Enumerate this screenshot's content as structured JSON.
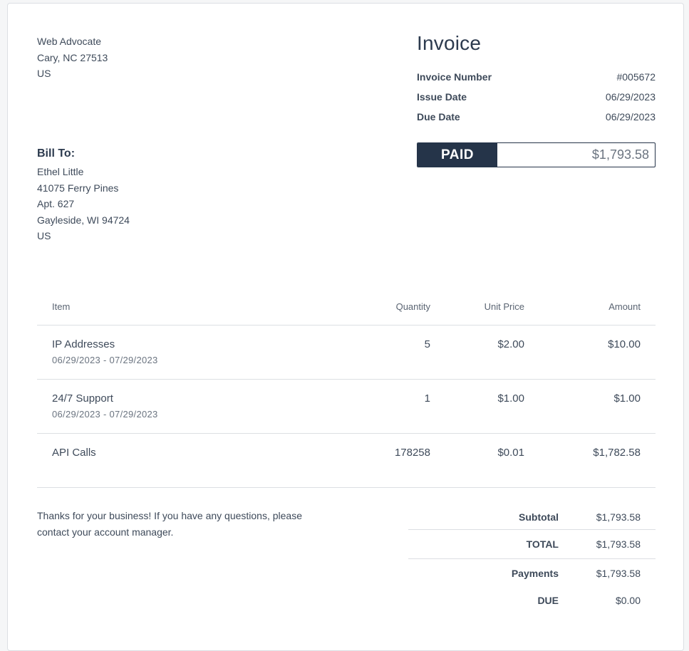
{
  "sender": {
    "name": "Web Advocate",
    "city_line": "Cary, NC 27513",
    "country": "US"
  },
  "invoice": {
    "title": "Invoice",
    "meta": [
      {
        "label": "Invoice Number",
        "value": "#005672"
      },
      {
        "label": "Issue Date",
        "value": "06/29/2023"
      },
      {
        "label": "Due Date",
        "value": "06/29/2023"
      }
    ],
    "status": "PAID",
    "status_amount": "$1,793.58"
  },
  "bill_to": {
    "title": "Bill To:",
    "lines": [
      "Ethel Little",
      "41075 Ferry Pines",
      "Apt. 627",
      "Gayleside, WI 94724",
      "US"
    ]
  },
  "table": {
    "headers": {
      "item": "Item",
      "quantity": "Quantity",
      "unit_price": "Unit Price",
      "amount": "Amount"
    },
    "rows": [
      {
        "item": "IP Addresses",
        "period": "06/29/2023 - 07/29/2023",
        "quantity": "5",
        "unit_price": "$2.00",
        "amount": "$10.00"
      },
      {
        "item": "24/7 Support",
        "period": "06/29/2023 - 07/29/2023",
        "quantity": "1",
        "unit_price": "$1.00",
        "amount": "$1.00"
      },
      {
        "item": "API Calls",
        "period": "",
        "quantity": "178258",
        "unit_price": "$0.01",
        "amount": "$1,782.58"
      }
    ]
  },
  "footer": {
    "thanks": "Thanks for your business! If you have any questions, please contact your account manager."
  },
  "totals": {
    "subtotal_label": "Subtotal",
    "subtotal": "$1,793.58",
    "total_label": "TOTAL",
    "total": "$1,793.58",
    "payments_label": "Payments",
    "payments": "$1,793.58",
    "due_label": "DUE",
    "due": "$0.00"
  },
  "colors": {
    "accent_navy": "#253449",
    "text": "#3e4a5a",
    "border": "#dcdfe3"
  }
}
